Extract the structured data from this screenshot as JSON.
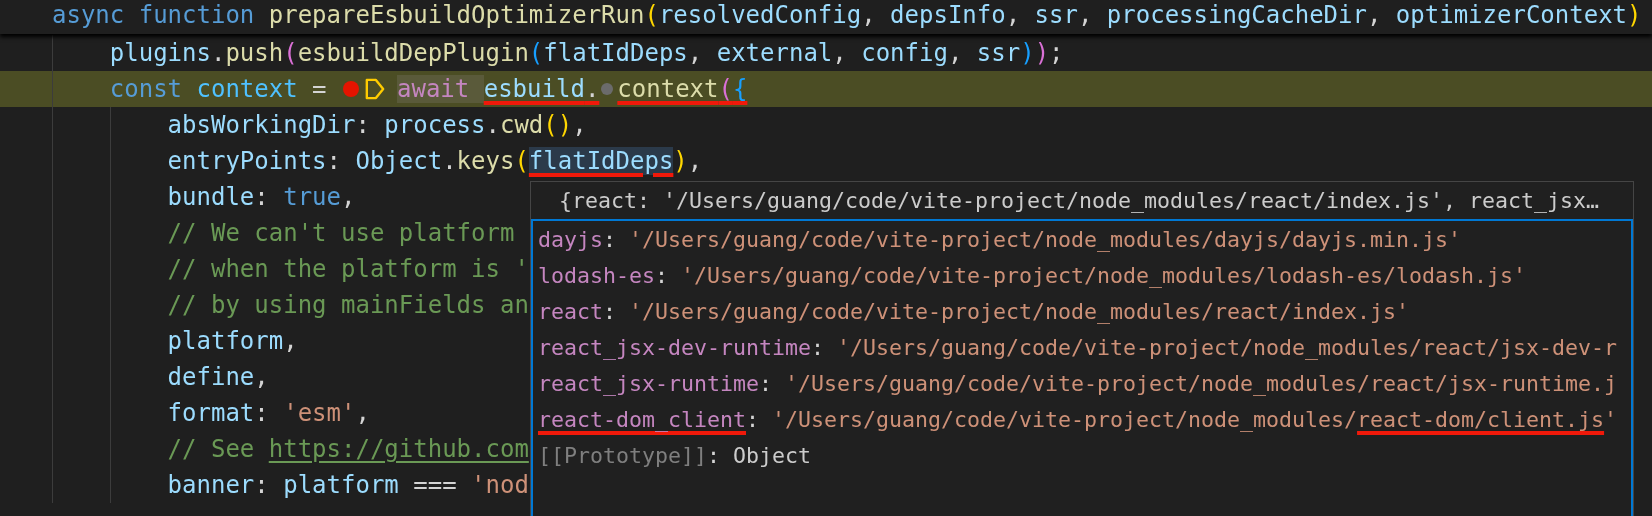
{
  "editor": {
    "sticky_line": {
      "tokens": [
        {
          "kind": "keyword",
          "text": "async function "
        },
        {
          "kind": "function",
          "text": "prepareEsbuildOptimizerRun"
        },
        {
          "kind": "open",
          "text": "("
        },
        {
          "kind": "variable",
          "text": "resolvedConfig"
        },
        {
          "kind": "punctuation",
          "text": ", "
        },
        {
          "kind": "variable",
          "text": "depsInfo"
        },
        {
          "kind": "punctuation",
          "text": ", "
        },
        {
          "kind": "variable",
          "text": "ssr"
        },
        {
          "kind": "punctuation",
          "text": ", "
        },
        {
          "kind": "variable",
          "text": "processingCacheDir"
        },
        {
          "kind": "punctuation",
          "text": ", "
        },
        {
          "kind": "variable",
          "text": "optimizerContext"
        },
        {
          "kind": "close",
          "text": ")"
        }
      ],
      "children": [
        {
          "current": false,
          "segments": [
            {
              "kind": "code",
              "tokens": [
                {
                  "kind": "variable",
                  "text": "plugins"
                },
                {
                  "kind": "punctuation",
                  "text": "."
                },
                {
                  "kind": "function",
                  "text": "push"
                },
                {
                  "kind": "open",
                  "text": "("
                },
                {
                  "kind": "function",
                  "text": "esbuildDepPlugin"
                },
                {
                  "kind": "open",
                  "text": "("
                },
                {
                  "kind": "variable",
                  "text": "flatIdDeps"
                },
                {
                  "kind": "punctuation",
                  "text": ", "
                },
                {
                  "kind": "variable",
                  "text": "external"
                },
                {
                  "kind": "punctuation",
                  "text": ", "
                },
                {
                  "kind": "variable",
                  "text": "config"
                },
                {
                  "kind": "punctuation",
                  "text": ", "
                },
                {
                  "kind": "variable",
                  "text": "ssr"
                },
                {
                  "kind": "close",
                  "text": ")"
                },
                {
                  "kind": "close",
                  "text": ")"
                },
                {
                  "kind": "punctuation",
                  "text": ";"
                }
              ]
            }
          ]
        },
        {
          "current": true,
          "segments": [
            {
              "kind": "code",
              "tokens": [
                {
                  "kind": "keyword",
                  "text": "const "
                },
                {
                  "kind": "constant",
                  "text": "context"
                },
                {
                  "kind": "punctuation",
                  "text": " = "
                }
              ]
            },
            {
              "kind": "breakpoint"
            },
            {
              "kind": "current_statement"
            },
            {
              "kind": "code",
              "tokens": [
                {
                  "kind": "control",
                  "text": "await "
                },
                {
                  "kind": "variable",
                  "text": "esbuild",
                  "underlined": true
                },
                {
                  "kind": "punctuation",
                  "text": ".",
                  "underlined": true
                }
              ]
            },
            {
              "kind": "inline_breakpoint"
            },
            {
              "kind": "code",
              "tokens": [
                {
                  "kind": "function",
                  "text": "context",
                  "underlined": true
                },
                {
                  "kind": "open",
                  "text": "(",
                  "underlined": true
                },
                {
                  "kind": "open",
                  "text": "{",
                  "underlined": true
                }
              ]
            }
          ],
          "children": [
            {
              "current": false,
              "segments": [
                {
                  "kind": "code",
                  "tokens": [
                    {
                      "kind": "variable",
                      "text": "absWorkingDir"
                    },
                    {
                      "kind": "punctuation",
                      "text": ": "
                    },
                    {
                      "kind": "variable",
                      "text": "process"
                    },
                    {
                      "kind": "punctuation",
                      "text": "."
                    },
                    {
                      "kind": "function",
                      "text": "cwd"
                    },
                    {
                      "kind": "open",
                      "text": "("
                    },
                    {
                      "kind": "close",
                      "text": ")"
                    },
                    {
                      "kind": "punctuation",
                      "text": ","
                    }
                  ]
                }
              ]
            },
            {
              "current": false,
              "segments": [
                {
                  "kind": "code",
                  "tokens": [
                    {
                      "kind": "variable",
                      "text": "entryPoints"
                    },
                    {
                      "kind": "punctuation",
                      "text": ": "
                    },
                    {
                      "kind": "variable",
                      "text": "Object"
                    },
                    {
                      "kind": "punctuation",
                      "text": "."
                    },
                    {
                      "kind": "function",
                      "text": "keys"
                    },
                    {
                      "kind": "open",
                      "text": "("
                    },
                    {
                      "kind": "variable",
                      "text": "flatIdDeps",
                      "underlined": true,
                      "hovered": true
                    },
                    {
                      "kind": "close",
                      "text": ")"
                    },
                    {
                      "kind": "punctuation",
                      "text": ","
                    }
                  ]
                }
              ]
            },
            {
              "current": false,
              "segments": [
                {
                  "kind": "code",
                  "tokens": [
                    {
                      "kind": "variable",
                      "text": "bundle"
                    },
                    {
                      "kind": "punctuation",
                      "text": ": "
                    },
                    {
                      "kind": "keyword",
                      "text": "true"
                    },
                    {
                      "kind": "punctuation",
                      "text": ","
                    }
                  ]
                }
              ]
            },
            {
              "current": false,
              "segments": [
                {
                  "kind": "code",
                  "tokens": [
                    {
                      "kind": "comment",
                      "text": "// We can't use platform"
                    }
                  ]
                }
              ]
            },
            {
              "current": false,
              "segments": [
                {
                  "kind": "code",
                  "tokens": [
                    {
                      "kind": "comment",
                      "text": "// when the platform is '"
                    }
                  ]
                }
              ]
            },
            {
              "current": false,
              "segments": [
                {
                  "kind": "code",
                  "tokens": [
                    {
                      "kind": "comment",
                      "text": "// by using mainFields an"
                    }
                  ]
                }
              ]
            },
            {
              "current": false,
              "segments": [
                {
                  "kind": "code",
                  "tokens": [
                    {
                      "kind": "variable",
                      "text": "platform"
                    },
                    {
                      "kind": "punctuation",
                      "text": ","
                    }
                  ]
                }
              ]
            },
            {
              "current": false,
              "segments": [
                {
                  "kind": "code",
                  "tokens": [
                    {
                      "kind": "variable",
                      "text": "define"
                    },
                    {
                      "kind": "punctuation",
                      "text": ","
                    }
                  ]
                }
              ]
            },
            {
              "current": false,
              "segments": [
                {
                  "kind": "code",
                  "tokens": [
                    {
                      "kind": "variable",
                      "text": "format"
                    },
                    {
                      "kind": "punctuation",
                      "text": ": "
                    },
                    {
                      "kind": "string",
                      "text": "'esm'"
                    },
                    {
                      "kind": "punctuation",
                      "text": ","
                    }
                  ]
                }
              ]
            },
            {
              "current": false,
              "segments": [
                {
                  "kind": "code",
                  "tokens": [
                    {
                      "kind": "comment",
                      "text": "// See "
                    }
                  ]
                },
                {
                  "kind": "link",
                  "tokens": [
                    {
                      "kind": "comment",
                      "text": "https://github.com"
                    }
                  ]
                }
              ]
            },
            {
              "current": false,
              "segments": [
                {
                  "kind": "code",
                  "tokens": [
                    {
                      "kind": "variable",
                      "text": "banner"
                    },
                    {
                      "kind": "punctuation",
                      "text": ": "
                    },
                    {
                      "kind": "variable",
                      "text": "platform"
                    },
                    {
                      "kind": "punctuation",
                      "text": " === "
                    },
                    {
                      "kind": "string",
                      "text": "'nod"
                    }
                  ]
                }
              ]
            }
          ]
        }
      ]
    }
  },
  "hover": {
    "summary": "{react: '/Users/guang/code/vite-project/node_modules/react/index.js', react_jsx…",
    "entries": [
      {
        "tokens": [
          {
            "kind": "property",
            "text": "dayjs"
          },
          {
            "kind": "punctuation",
            "text": ": "
          },
          {
            "kind": "string",
            "text": "'/Users/guang/code/vite-project/node_modules/dayjs/dayjs.min.js'"
          }
        ]
      },
      {
        "tokens": [
          {
            "kind": "property",
            "text": "lodash-es"
          },
          {
            "kind": "punctuation",
            "text": ": "
          },
          {
            "kind": "string",
            "text": "'/Users/guang/code/vite-project/node_modules/lodash-es/lodash.js'"
          }
        ]
      },
      {
        "tokens": [
          {
            "kind": "property",
            "text": "react"
          },
          {
            "kind": "punctuation",
            "text": ": "
          },
          {
            "kind": "string",
            "text": "'/Users/guang/code/vite-project/node_modules/react/index.js'"
          }
        ]
      },
      {
        "tokens": [
          {
            "kind": "property",
            "text": "react_jsx-dev-runtime"
          },
          {
            "kind": "punctuation",
            "text": ": "
          },
          {
            "kind": "string",
            "text": "'/Users/guang/code/vite-project/node_modules/react/jsx-dev-r"
          }
        ]
      },
      {
        "tokens": [
          {
            "kind": "property",
            "text": "react_jsx-runtime"
          },
          {
            "kind": "punctuation",
            "text": ": "
          },
          {
            "kind": "string",
            "text": "'/Users/guang/code/vite-project/node_modules/react/jsx-runtime.j"
          }
        ]
      },
      {
        "tokens": [
          {
            "kind": "property",
            "text": "react-dom_client",
            "underlined": true
          },
          {
            "kind": "punctuation",
            "text": ": "
          },
          {
            "kind": "string",
            "text": "'/Users/guang/code/vite-project/node_modules/"
          },
          {
            "kind": "string",
            "text": "react-dom/client.js",
            "underlined": true
          },
          {
            "kind": "string",
            "text": "'"
          }
        ]
      },
      {
        "tokens": [
          {
            "kind": "meta",
            "text": "[[Prototype]]"
          },
          {
            "kind": "punctuation",
            "text": ": "
          },
          {
            "kind": "value",
            "text": "Object"
          }
        ]
      }
    ]
  }
}
